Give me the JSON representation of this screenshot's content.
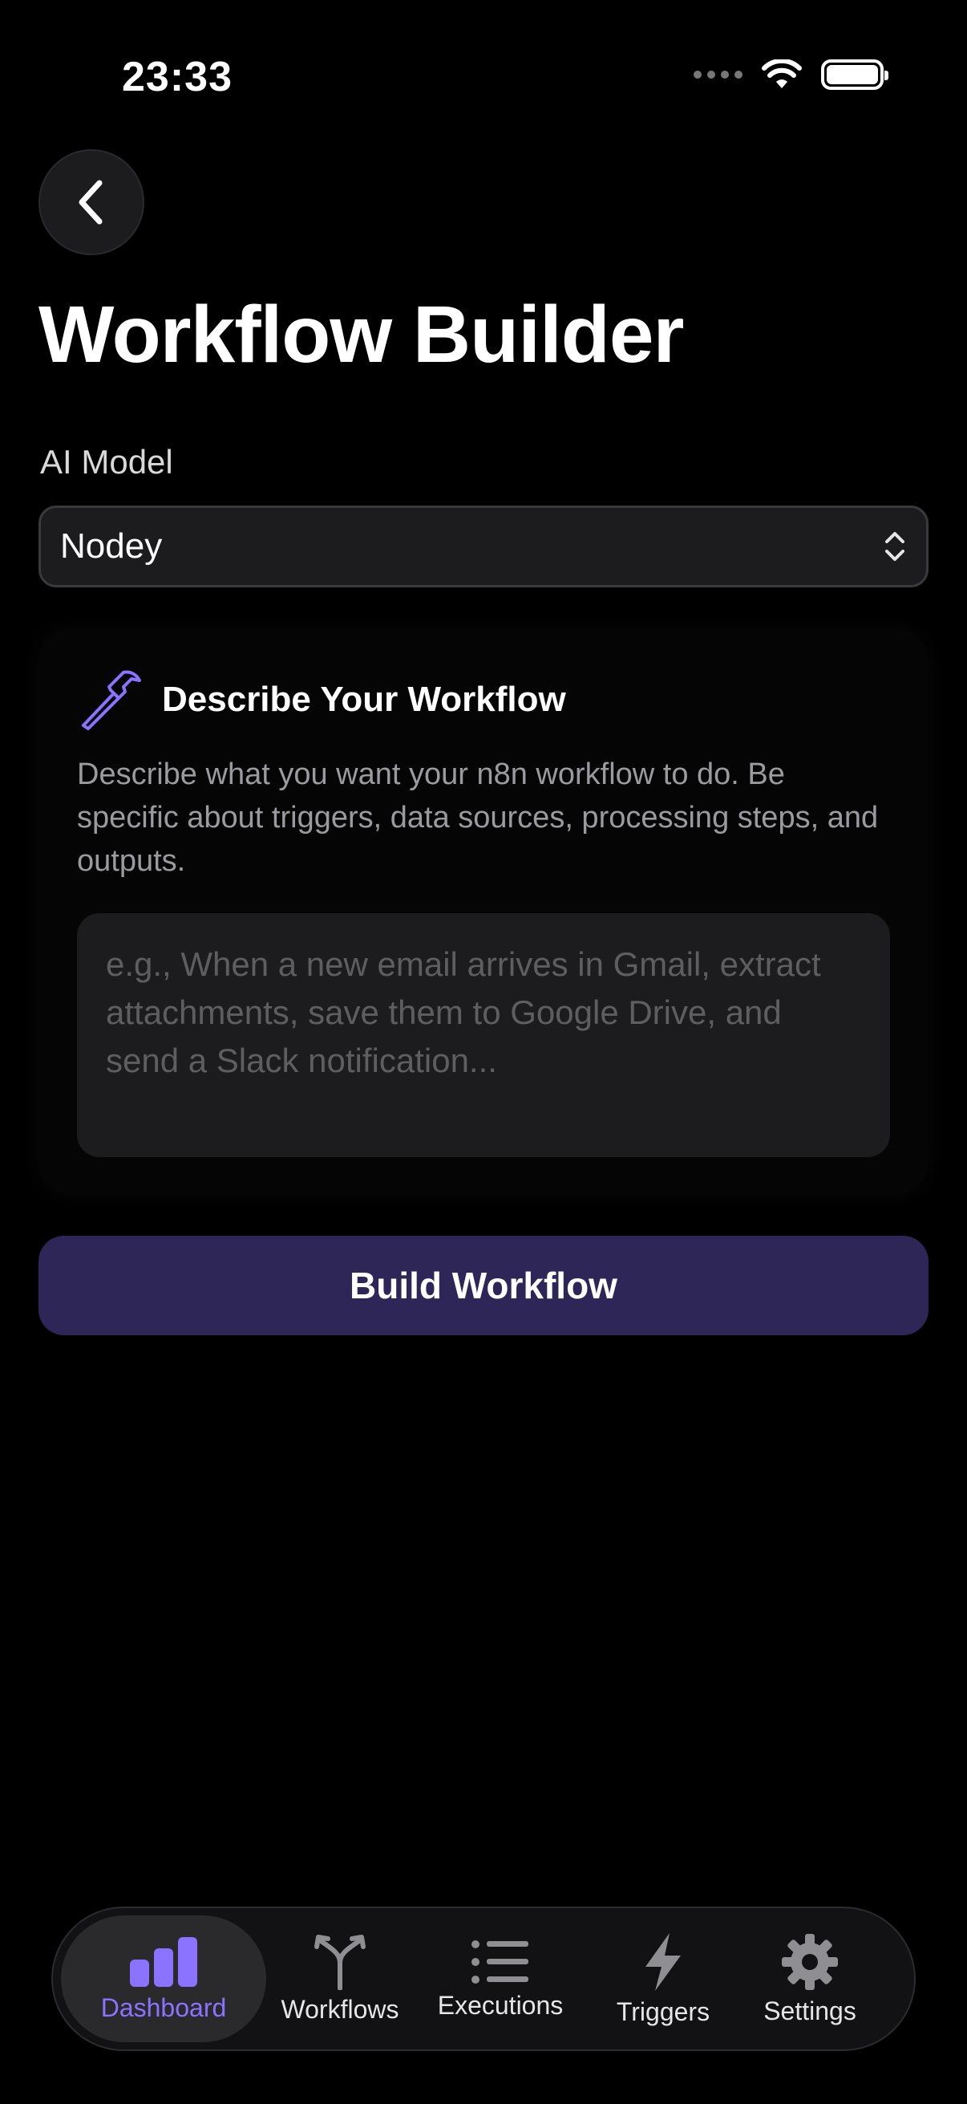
{
  "status_bar": {
    "time": "23:33"
  },
  "header": {
    "title": "Workflow Builder"
  },
  "model": {
    "label": "AI Model",
    "selected": "Nodey"
  },
  "card": {
    "title": "Describe Your Workflow",
    "description": "Describe what you want your n8n workflow to do. Be specific about triggers, data sources, processing steps, and outputs.",
    "input_placeholder": "e.g., When a new email arrives in Gmail, extract attachments, save them to Google Drive, and send a Slack notification...",
    "input_value": ""
  },
  "build_button": {
    "label": "Build Workflow"
  },
  "tabs": [
    {
      "label": "Dashboard",
      "icon": "chart-bar-icon",
      "active": true
    },
    {
      "label": "Workflows",
      "icon": "branch-icon",
      "active": false
    },
    {
      "label": "Executions",
      "icon": "list-icon",
      "active": false
    },
    {
      "label": "Triggers",
      "icon": "bolt-icon",
      "active": false
    },
    {
      "label": "Settings",
      "icon": "gear-icon",
      "active": false
    }
  ],
  "colors": {
    "accent": "#8b72ff",
    "button": "#2e2656",
    "background": "#000000"
  }
}
